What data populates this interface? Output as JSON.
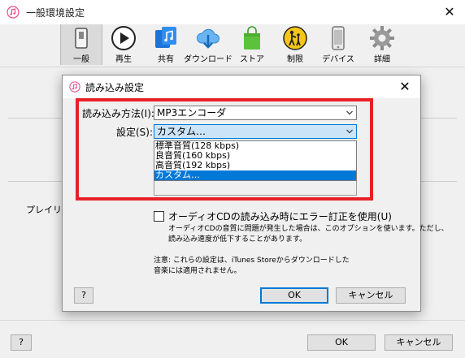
{
  "window": {
    "title": "一般環境設定",
    "close_glyph": "✕"
  },
  "toolbar": {
    "items": [
      {
        "label": "一般",
        "icon": "general-switch-icon",
        "active": true
      },
      {
        "label": "再生",
        "icon": "play-icon"
      },
      {
        "label": "共有",
        "icon": "music-share-icon"
      },
      {
        "label": "ダウンロード",
        "icon": "cloud-download-icon"
      },
      {
        "label": "ストア",
        "icon": "store-bag-icon"
      },
      {
        "label": "制限",
        "icon": "parental-restriction-icon"
      },
      {
        "label": "デバイス",
        "icon": "device-phone-icon"
      },
      {
        "label": "詳細",
        "icon": "gear-icon"
      }
    ]
  },
  "main": {
    "playlist_label": "プレイリス"
  },
  "footer": {
    "help_label": "?",
    "ok_label": "OK",
    "cancel_label": "キャンセル"
  },
  "dialog": {
    "title": "読み込み設定",
    "close_glyph": "✕",
    "import_method_label": "読み込み方法(I):",
    "import_method_value": "MP3エンコーダ",
    "setting_label": "設定(S):",
    "setting_value": "カスタム…",
    "setting_options": [
      "標準音質(128 kbps)",
      "良音質(160 kbps)",
      "高音質(192 kbps)",
      "カスタム…"
    ],
    "setting_selected_index": 3,
    "error_correction_label": "オーディオCDの読み込み時にエラー訂正を使用(U)",
    "error_correction_checked": false,
    "error_correction_note": [
      "オーディオCDの音質に問題が発生した場合は、このオプションを使います。ただし、",
      "読み込み速度が低下することがあります。"
    ],
    "caution_note": [
      "注意: これらの設定は、iTunes Storeからダウンロードした",
      "音楽には適用されません。"
    ],
    "help_label": "?",
    "ok_label": "OK",
    "cancel_label": "キャンセル"
  },
  "colors": {
    "highlight_frame": "#e8202a",
    "selection_blue": "#0078d7",
    "focused_select_bg": "#cce4f7"
  }
}
